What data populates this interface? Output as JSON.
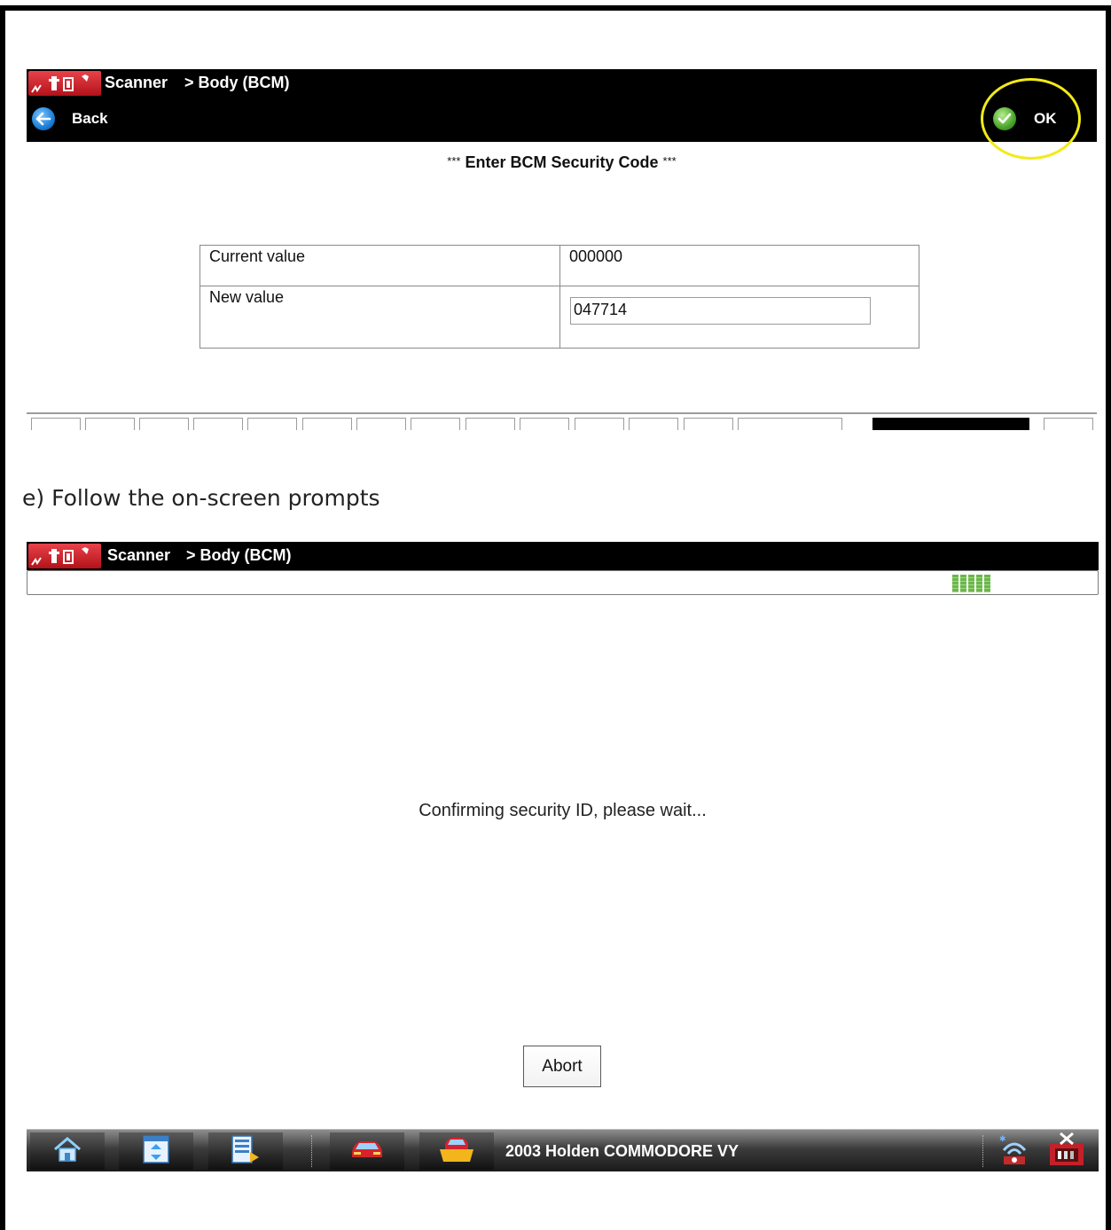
{
  "screen1": {
    "breadcrumb_app": "Scanner",
    "breadcrumb_section": "> Body (BCM)",
    "back_label": "Back",
    "ok_label": "OK",
    "prompt_stars_left": "***",
    "prompt_title": "Enter BCM Security Code",
    "prompt_stars_right": "***",
    "current_value_label": "Current value",
    "current_value": "000000",
    "new_value_label": "New value",
    "new_value": "047714"
  },
  "caption": "e)  Follow the on-screen prompts",
  "screen2": {
    "breadcrumb_app": "Scanner",
    "breadcrumb_section": "> Body (BCM)",
    "status_message": "Confirming security ID, please wait...",
    "abort_label": "Abort",
    "vehicle": "2003 Holden COMMODORE VY"
  },
  "colors": {
    "titlebar": "#000000",
    "highlight_ring": "#f2ea18",
    "progress_green": "#6ab84a",
    "logo_red": "#c41a22"
  },
  "icons": [
    "scanner-logo-icon",
    "back-arrow-icon",
    "ok-check-icon",
    "home-icon",
    "data-list-icon",
    "tools-icon",
    "vehicle-red-icon",
    "vehicle-yellow-icon",
    "wireless-icon",
    "exit-icon"
  ]
}
